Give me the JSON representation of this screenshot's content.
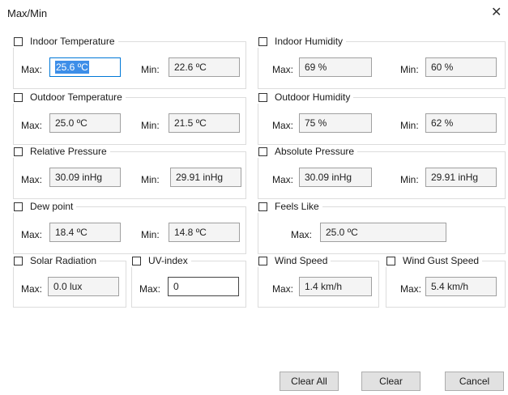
{
  "window": {
    "title": "Max/Min"
  },
  "groups": {
    "indoor_temp": {
      "label": "Indoor Temperature",
      "max_label": "Max:",
      "max_value": "25.6 ºC",
      "min_label": "Min:",
      "min_value": "22.6 ºC"
    },
    "indoor_hum": {
      "label": "Indoor Humidity",
      "max_label": "Max:",
      "max_value": "69 %",
      "min_label": "Min:",
      "min_value": "60 %"
    },
    "outdoor_temp": {
      "label": "Outdoor Temperature",
      "max_label": "Max:",
      "max_value": "25.0 ºC",
      "min_label": "Min:",
      "min_value": "21.5 ºC"
    },
    "outdoor_hum": {
      "label": "Outdoor Humidity",
      "max_label": "Max:",
      "max_value": "75 %",
      "min_label": "Min:",
      "min_value": "62 %"
    },
    "rel_pressure": {
      "label": "Relative Pressure",
      "max_label": "Max:",
      "max_value": "30.09 inHg",
      "min_label": "Min:",
      "min_value": "29.91 inHg"
    },
    "abs_pressure": {
      "label": "Absolute Pressure",
      "max_label": "Max:",
      "max_value": "30.09 inHg",
      "min_label": "Min:",
      "min_value": "29.91 inHg"
    },
    "dew_point": {
      "label": "Dew point",
      "max_label": "Max:",
      "max_value": "18.4 ºC",
      "min_label": "Min:",
      "min_value": "14.8 ºC"
    },
    "feels_like": {
      "label": "Feels Like",
      "max_label": "Max:",
      "max_value": "25.0 ºC"
    },
    "solar": {
      "label": "Solar Radiation",
      "max_label": "Max:",
      "max_value": "0.0 lux"
    },
    "uv": {
      "label": "UV-index",
      "max_label": "Max:",
      "max_value": "0"
    },
    "wind_speed": {
      "label": "Wind Speed",
      "max_label": "Max:",
      "max_value": "1.4 km/h"
    },
    "wind_gust": {
      "label": "Wind Gust Speed",
      "max_label": "Max:",
      "max_value": "5.4 km/h"
    }
  },
  "buttons": {
    "clear_all": "Clear All",
    "clear": "Clear",
    "cancel": "Cancel"
  },
  "icons": {
    "close": "close-icon"
  }
}
